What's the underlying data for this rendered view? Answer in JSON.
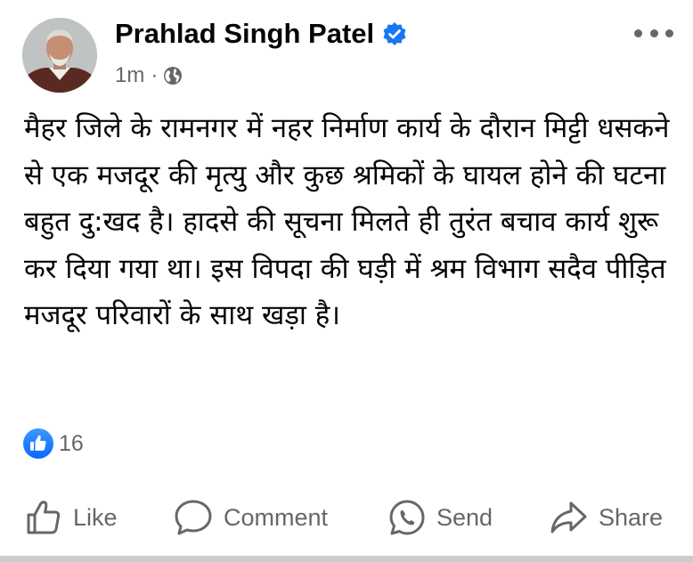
{
  "post": {
    "author": "Prahlad Singh Patel",
    "timestamp": "1m",
    "separator": "·",
    "privacy_icon": "globe-icon",
    "verified_icon": "verified-badge-icon",
    "more_icon": "more-options-icon",
    "text": "मैहर जिले के रामनगर में नहर निर्माण कार्य के दौरान मिट्टी धसकने से एक मजदूर की मृत्यु और कुछ श्रमिकों के घायल होने की घटना बहुत दु:खद है। हादसे की सूचना मिलते ही तुरंत बचाव कार्य शुरू कर दिया गया था। इस विपदा की घड़ी में श्रम विभाग सदैव पीड़ित मजदूर परिवारों के साथ खड़ा है।"
  },
  "reactions": {
    "icon": "like-reaction-icon",
    "count": "16"
  },
  "actions": {
    "like": {
      "label": "Like",
      "icon": "thumbs-up-icon"
    },
    "comment": {
      "label": "Comment",
      "icon": "comment-icon"
    },
    "send": {
      "label": "Send",
      "icon": "whatsapp-icon"
    },
    "share": {
      "label": "Share",
      "icon": "share-icon"
    }
  },
  "colors": {
    "text_primary": "#050505",
    "text_secondary": "#65676b",
    "brand_blue": "#1877f2",
    "divider": "#c9ccd1"
  }
}
